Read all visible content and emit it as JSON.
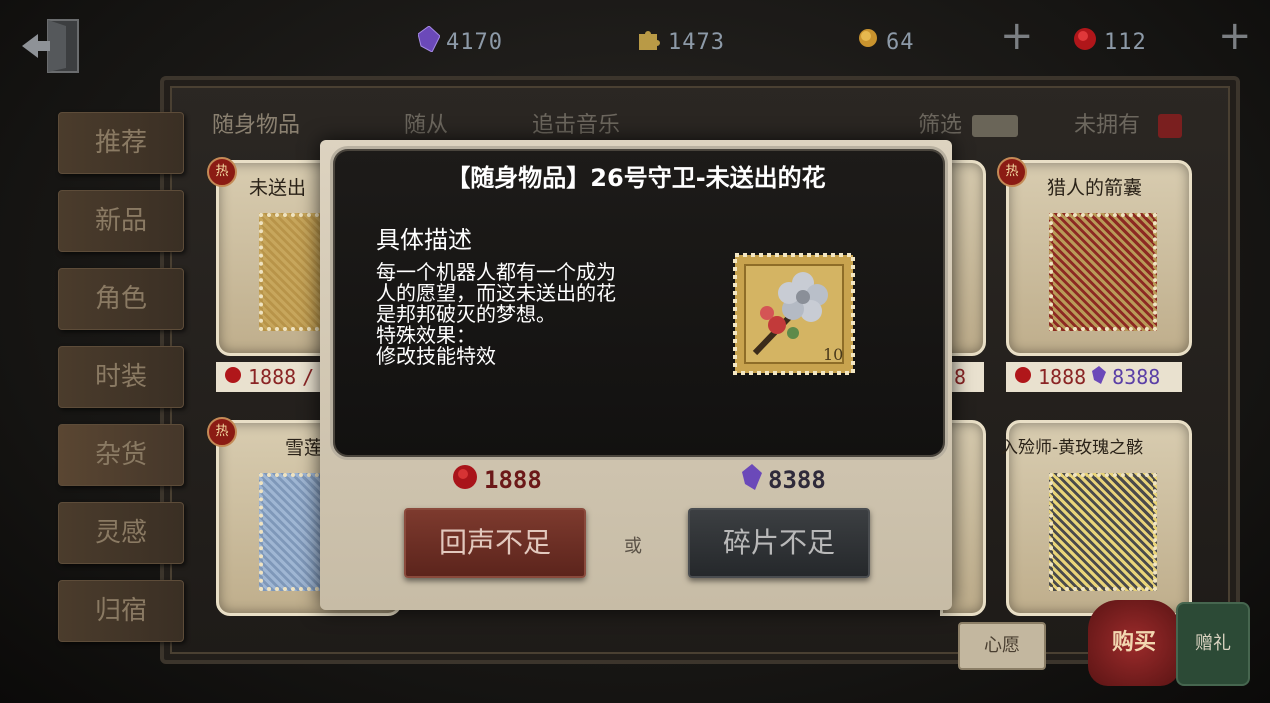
{
  "currencies": [
    {
      "icon": "purple-crystal-icon",
      "value": "4170",
      "color": "#7a5cc7"
    },
    {
      "icon": "puzzle-piece-icon",
      "value": "1473",
      "color": "#c9a84f"
    },
    {
      "icon": "gold-coin-icon",
      "value": "64",
      "color": "#d7a53c"
    },
    {
      "icon": "red-echo-icon",
      "value": "112",
      "color": "#c41b1b"
    }
  ],
  "plus_symbol": "+",
  "tabs": [
    "随身物品",
    "随从",
    "追击音乐"
  ],
  "filter_label": "筛选",
  "unowned_label": "未拥有",
  "side_tabs": [
    "推荐",
    "新品",
    "角色",
    "时装",
    "杂货",
    "灵感",
    "归宿"
  ],
  "cards": {
    "top_left": {
      "title": "未送出",
      "hot": "热",
      "price_echo": "1888",
      "price_sep": "/"
    },
    "top_right": {
      "title": "猎人的箭囊",
      "hot": "热",
      "price_echo": "1888",
      "price_frag": "8388"
    },
    "mid_right_edge": {
      "price_frag_partial": "8"
    },
    "bottom_left": {
      "title": "雪莲",
      "hot": "热"
    },
    "bottom_right": {
      "title": "入殓师-黄玫瑰之骸"
    },
    "ghost_title": "未送出的花"
  },
  "modal": {
    "title": "【随身物品】26号守卫-未送出的花",
    "heading": "具体描述",
    "desc_lines": [
      "每一个机器人都有一个成为",
      "人的愿望，而这未送出的花",
      "是邦邦破灭的梦想。",
      "特殊效果：",
      "修改技能特效"
    ],
    "stamp_value": "10",
    "price_echo": "1888",
    "price_frag": "8388",
    "btn_echo": "回声不足",
    "btn_frag": "碎片不足",
    "or_label": "或"
  },
  "bottom_buttons": {
    "wish": "心愿",
    "buy": "购买",
    "gift": "赠礼"
  }
}
